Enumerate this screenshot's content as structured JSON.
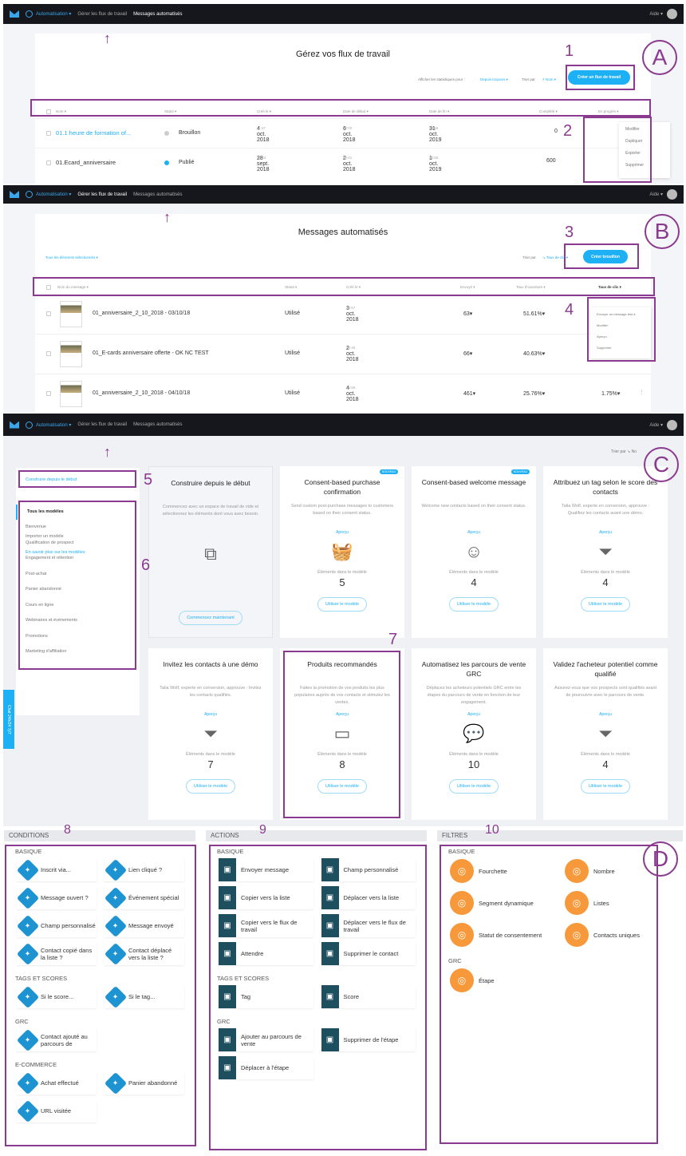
{
  "colors": {
    "accent": "#1eb0f5",
    "nav": "#15171c",
    "annotation": "#8a3a8f",
    "conditions": "#1d93d2",
    "actions": "#1e4f5f",
    "filters": "#f7993b"
  },
  "nav": {
    "automation": "Automatisation ▾",
    "workflows": "Gérer les flux de travail",
    "messages": "Messages automatisés",
    "help": "Aide ▾"
  },
  "panelA": {
    "letter": "A",
    "title": "Gérez vos flux de travail",
    "stats_label": "Afficher les statistiques pour :",
    "stats_value": "Depuis toujours ▾",
    "sort_label": "Trier par",
    "sort_value": "↗ Nom ▾",
    "create": "Créer un flux de travail",
    "headers": [
      "Nom ▾",
      "Statut ▾",
      "Créé le ▾",
      "Date de début ▾",
      "Date de fin ▾",
      "Complété ▾",
      "En progrès ▾"
    ],
    "rows": [
      {
        "name": "01.1 heure de formation of...",
        "status": "Brouillon",
        "created": "4 oct. 2018",
        "created_t": "11:27",
        "start": "6 oct. 2018",
        "start_t": "07:00",
        "end": "31 oct. 2019",
        "end_t": "23:59",
        "done": "0"
      },
      {
        "name": "01.Ecard_anniversaire",
        "status": "Publié",
        "created": "28 sept. 2018",
        "created_t": "18:23",
        "start": "2 oct. 2018",
        "start_t": "00:01",
        "end": "1 oct. 2019",
        "end_t": "23:59",
        "done": "600"
      }
    ],
    "menu": [
      "Modifier",
      "Dupliquer",
      "Exporter",
      "Supprimer"
    ]
  },
  "panelB": {
    "letter": "B",
    "title": "Messages automatisés",
    "filter": "Tous les éléments sélectionnés ▾",
    "sort_label": "Trier par",
    "sort_value": "↘ Taux de clic ▾",
    "create": "Créer brouillon",
    "headers": [
      "Nom du message ▾",
      "Statut ▾",
      "Créé le ▾",
      "Envoyé ▾",
      "Taux d'ouverture ▾",
      "Taux de clic ▾"
    ],
    "rows": [
      {
        "name": "01_anniversaire_2_10_2018 - 03/10/18",
        "status": "Utilisé",
        "created": "3 oct. 2018",
        "created_t": "20:57",
        "sent": "63▾",
        "open": "51.61%▾",
        "click": ""
      },
      {
        "name": "01_E-cards anniversaire offerte - OK NC TEST",
        "status": "Utilisé",
        "created": "2 oct. 2018",
        "created_t": "20:45",
        "sent": "66▾",
        "open": "40.63%▾",
        "click": ""
      },
      {
        "name": "01_anniversaire_2_10_2018 - 04/10/18",
        "status": "Utilisé",
        "created": "4 oct. 2018",
        "created_t": "14:59",
        "sent": "461▾",
        "open": "25.76%▾",
        "click": "1.75%▾"
      }
    ],
    "menu": [
      "Envoyer un message test à",
      "Modifier",
      "Aperçu",
      "Supprimer"
    ]
  },
  "panelC": {
    "letter": "C",
    "sort": "Trier par ↘ No",
    "build": "Construire depuis le début",
    "categories": [
      "Tous les modèles",
      "Bienvenue",
      "Qualification de prospect",
      "Engagement et rétention",
      "Post-achat",
      "Panier abandonné",
      "Cours en ligne",
      "Webinaires et événements",
      "Promotions",
      "Marketing d'affiliation"
    ],
    "import": "Importer un modèle",
    "learn": "En savoir plus sur les modèles",
    "chat": "Chat 24h/24 7j/7",
    "elements_label": "Éléments dans le modèle",
    "preview": "Aperçu",
    "use": "Utiliser le modèle",
    "new_badge": "NOUVEAU",
    "start": {
      "title": "Construire depuis le début",
      "desc": "Commencez avec un espace de travail de vide et sélectionnez les éléments dont vous avez besoin.",
      "button": "Commencez maintenant",
      "icon": "flow-icon"
    },
    "cards": [
      {
        "title": "Consent-based purchase confirmation",
        "desc": "Send custom post-purchase messages to customers based on their consent status.",
        "count": "5",
        "icon": "basket-icon",
        "new": true
      },
      {
        "title": "Consent-based welcome message",
        "desc": "Welcome new contacts based on their consent status.",
        "count": "4",
        "icon": "smiley-icon",
        "new": true
      },
      {
        "title": "Attribuez un tag selon le score des contacts",
        "desc": "Talia Wolf, experte en conversion, approuve : Qualifiez les contacts avant une démo.",
        "count": "4",
        "icon": "funnel-icon"
      },
      {
        "title": "Invitez les contacts à une démo",
        "desc": "Talia Wolf, experte en conversion, approuve : Invitez les contacts qualifiés.",
        "count": "7",
        "icon": "funnel-icon"
      },
      {
        "title": "Produits recommandés",
        "desc": "Faites la promotion de vos produits les plus populaires auprès de vos contacts et stimulez les ventes.",
        "count": "8",
        "icon": "wallet-icon"
      },
      {
        "title": "Automatisez les parcours de vente GRC",
        "desc": "Déplacez les acheteurs potentiels GRC entre les étapes du parcours de vente en fonction de leur engagement.",
        "count": "10",
        "icon": "chat-icon"
      },
      {
        "title": "Validez l'acheteur potentiel comme qualifié",
        "desc": "Assurez-vous que vos prospects sont qualifiés avant de poursuivre avec le parcours de vente.",
        "count": "4",
        "icon": "funnel-icon"
      }
    ]
  },
  "panelD": {
    "letter": "D",
    "columns": [
      {
        "title": "CONDITIONS",
        "kind": "cond",
        "groups": [
          {
            "name": "BASIQUE",
            "items": [
              "Inscrit via...",
              "Lien cliqué ?",
              "Message ouvert ?",
              "Événement spécial",
              "Champ personnalisé",
              "Message envoyé",
              "Contact copié dans la liste ?",
              "Contact déplacé vers la liste ?"
            ]
          },
          {
            "name": "TAGS ET SCORES",
            "items": [
              "Si le score...",
              "Si le tag..."
            ]
          },
          {
            "name": "GRC",
            "items": [
              "Contact ajouté au parcours de"
            ]
          },
          {
            "name": "E-COMMERCE",
            "items": [
              "Achat effectué",
              "Panier abandonné",
              "URL visitée"
            ]
          }
        ]
      },
      {
        "title": "ACTIONS",
        "kind": "act",
        "groups": [
          {
            "name": "BASIQUE",
            "items": [
              "Envoyer message",
              "Champ personnalisé",
              "Copier vers la liste",
              "Déplacer vers la liste",
              "Copier vers le flux de travail",
              "Déplacer vers le flux de travail",
              "Attendre",
              "Supprimer le contact"
            ]
          },
          {
            "name": "TAGS ET SCORES",
            "items": [
              "Tag",
              "Score"
            ]
          },
          {
            "name": "GRC",
            "items": [
              "Ajouter au parcours de vente",
              "Supprimer de l'étape",
              "Déplacer à l'étape"
            ]
          }
        ]
      },
      {
        "title": "FILTRES",
        "kind": "fil",
        "groups": [
          {
            "name": "BASIQUE",
            "items": [
              "Fourchette",
              "Nombre",
              "Segment dynamique",
              "Listes",
              "Statut de consentement",
              "Contacts uniques"
            ]
          },
          {
            "name": "GRC",
            "items": [
              "Étape"
            ]
          }
        ]
      }
    ]
  },
  "annotations": [
    "1",
    "2",
    "3",
    "4",
    "5",
    "6",
    "7",
    "8",
    "9",
    "10"
  ]
}
